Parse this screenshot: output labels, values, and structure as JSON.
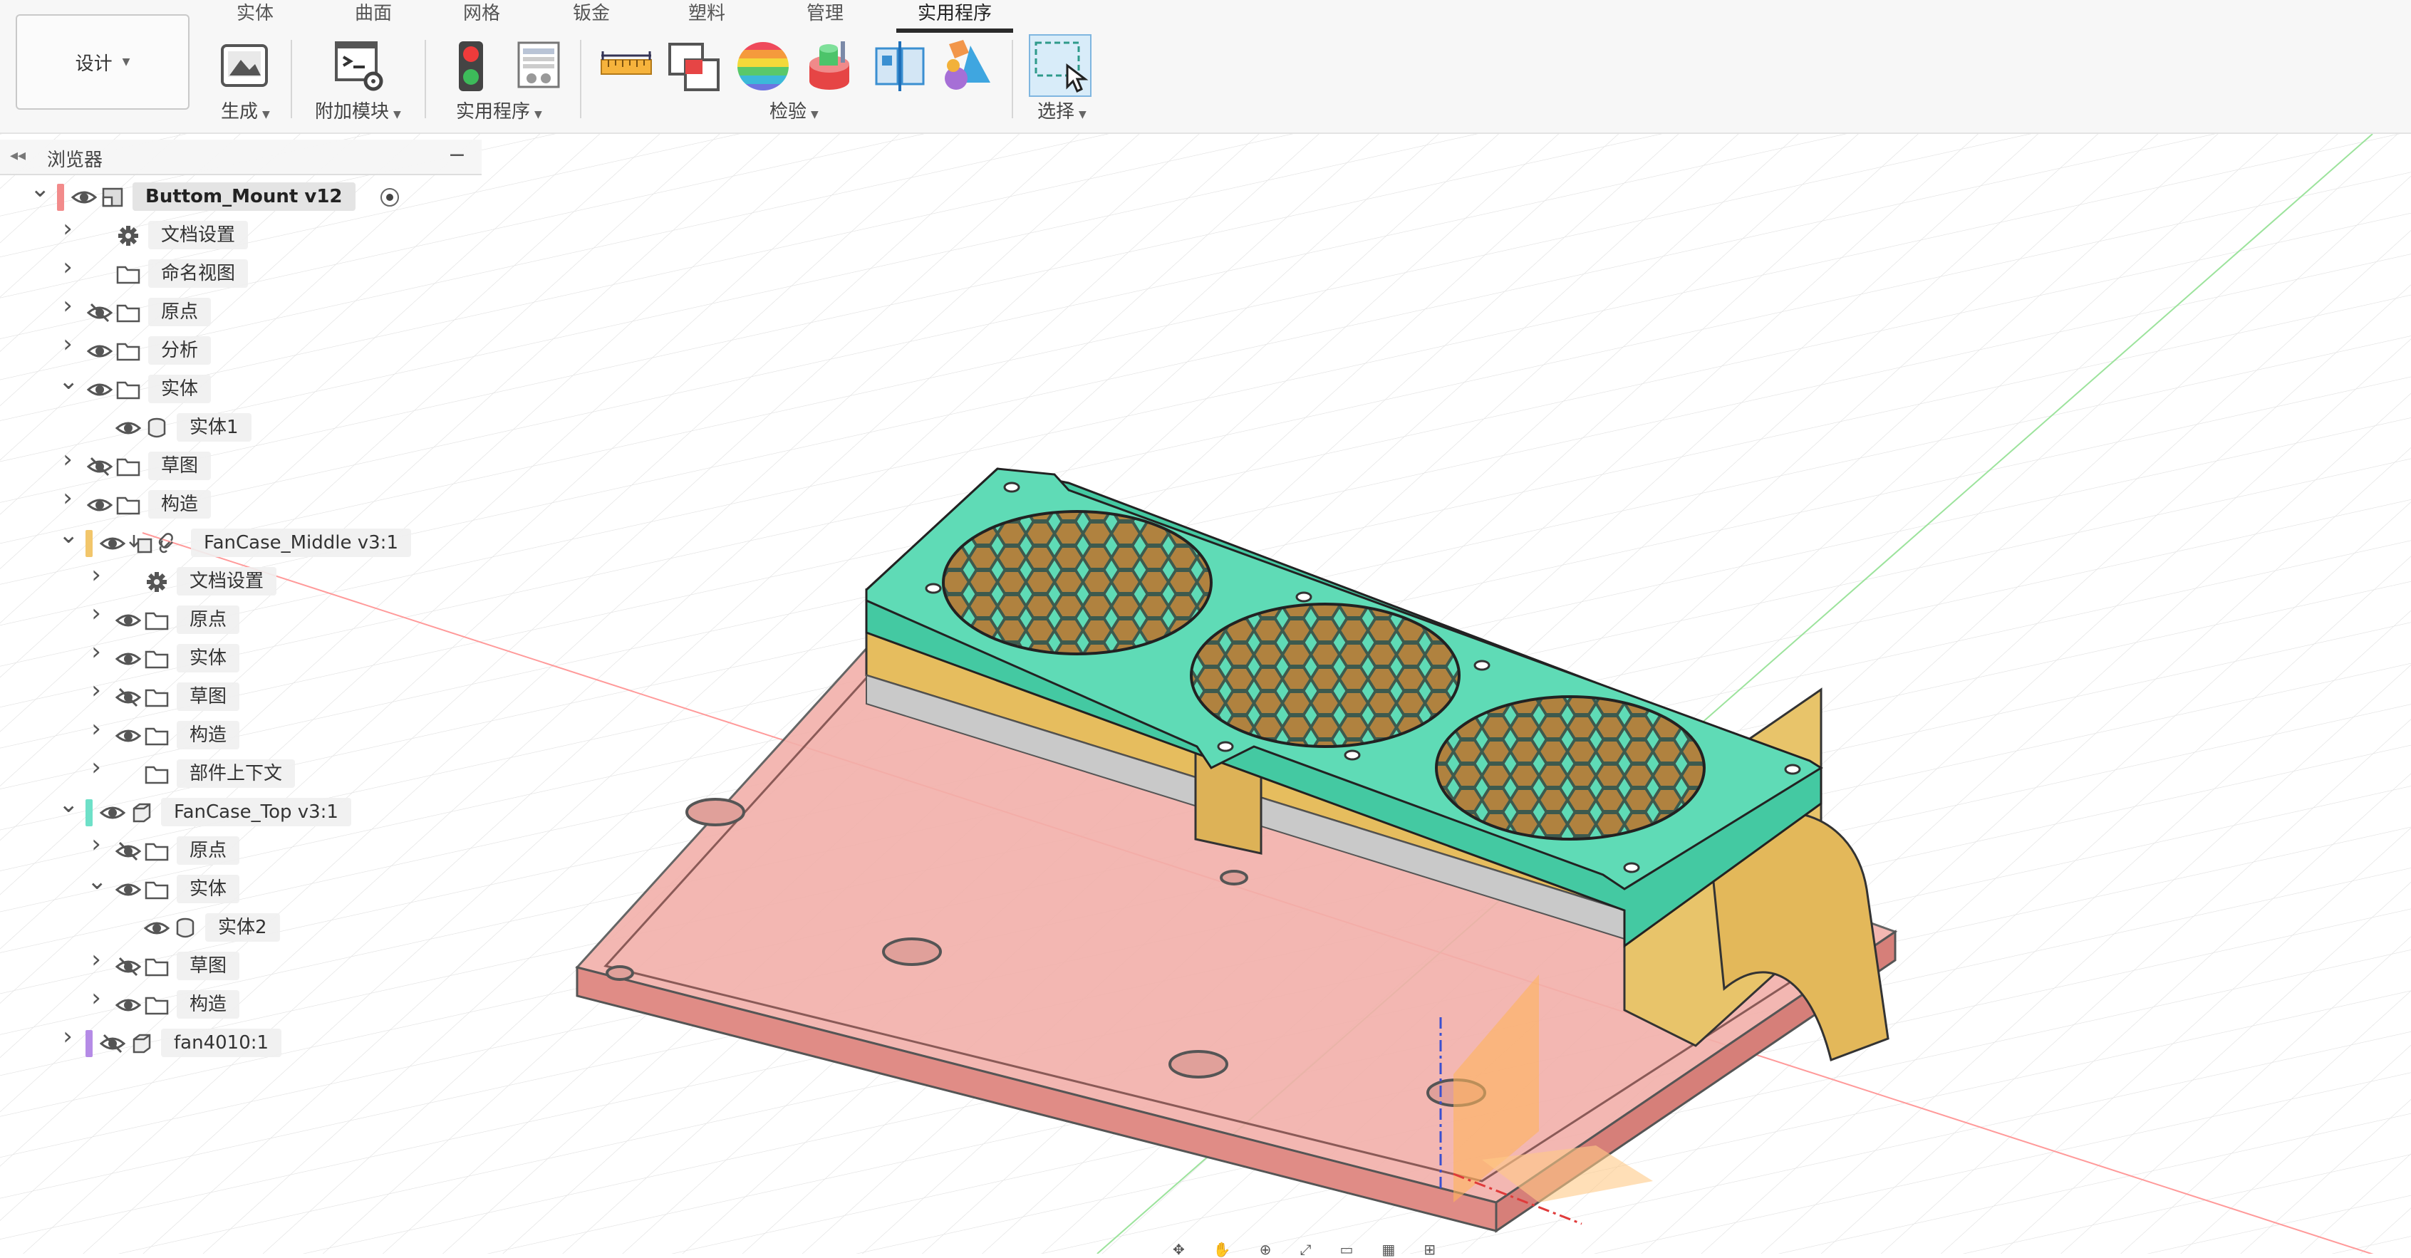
{
  "toolbar": {
    "workspace": "设计",
    "tabs": [
      {
        "label": "实体",
        "active": false
      },
      {
        "label": "曲面",
        "active": false
      },
      {
        "label": "网格",
        "active": false
      },
      {
        "label": "钣金",
        "active": false
      },
      {
        "label": "塑料",
        "active": false
      },
      {
        "label": "管理",
        "active": false
      },
      {
        "label": "实用程序",
        "active": true
      }
    ],
    "groups": {
      "generate": "生成",
      "addins": "附加模块",
      "utilities": "实用程序",
      "inspect": "检验",
      "select": "选择"
    },
    "icons": [
      "generate-icon",
      "script-addin-icon",
      "traffic-light-icon",
      "table-report-icon",
      "measure-icon",
      "interference-icon",
      "zebra-analysis-icon",
      "draft-analysis-icon",
      "section-analysis-icon",
      "component-color-icon",
      "window-select-icon"
    ]
  },
  "browser": {
    "title": "浏览器",
    "rows": [
      {
        "label": "Buttom_Mount v12",
        "depth": 0
      },
      {
        "label": "文档设置",
        "depth": 1
      },
      {
        "label": "命名视图",
        "depth": 1
      },
      {
        "label": "原点",
        "depth": 1
      },
      {
        "label": "分析",
        "depth": 1
      },
      {
        "label": "实体",
        "depth": 1
      },
      {
        "label": "实体1",
        "depth": 2
      },
      {
        "label": "草图",
        "depth": 1
      },
      {
        "label": "构造",
        "depth": 1
      },
      {
        "label": "FanCase_Middle v3:1",
        "depth": 1
      },
      {
        "label": "文档设置",
        "depth": 2
      },
      {
        "label": "原点",
        "depth": 2
      },
      {
        "label": "实体",
        "depth": 2
      },
      {
        "label": "草图",
        "depth": 2
      },
      {
        "label": "构造",
        "depth": 2
      },
      {
        "label": "部件上下文",
        "depth": 2
      },
      {
        "label": "FanCase_Top v3:1",
        "depth": 1
      },
      {
        "label": "原点",
        "depth": 2
      },
      {
        "label": "实体",
        "depth": 2
      },
      {
        "label": "实体2",
        "depth": 3
      },
      {
        "label": "草图",
        "depth": 2
      },
      {
        "label": "构造",
        "depth": 2
      },
      {
        "label": "fan4010:1",
        "depth": 1
      }
    ],
    "colors": {
      "root": "#f28b8b",
      "middle": "#f2c66b",
      "top": "#6ee0c8",
      "fan": "#b58be6"
    }
  },
  "model": {
    "base_color": "#f0a09a",
    "middle_color": "#e8c46a",
    "top_color": "#5fdbb6"
  }
}
